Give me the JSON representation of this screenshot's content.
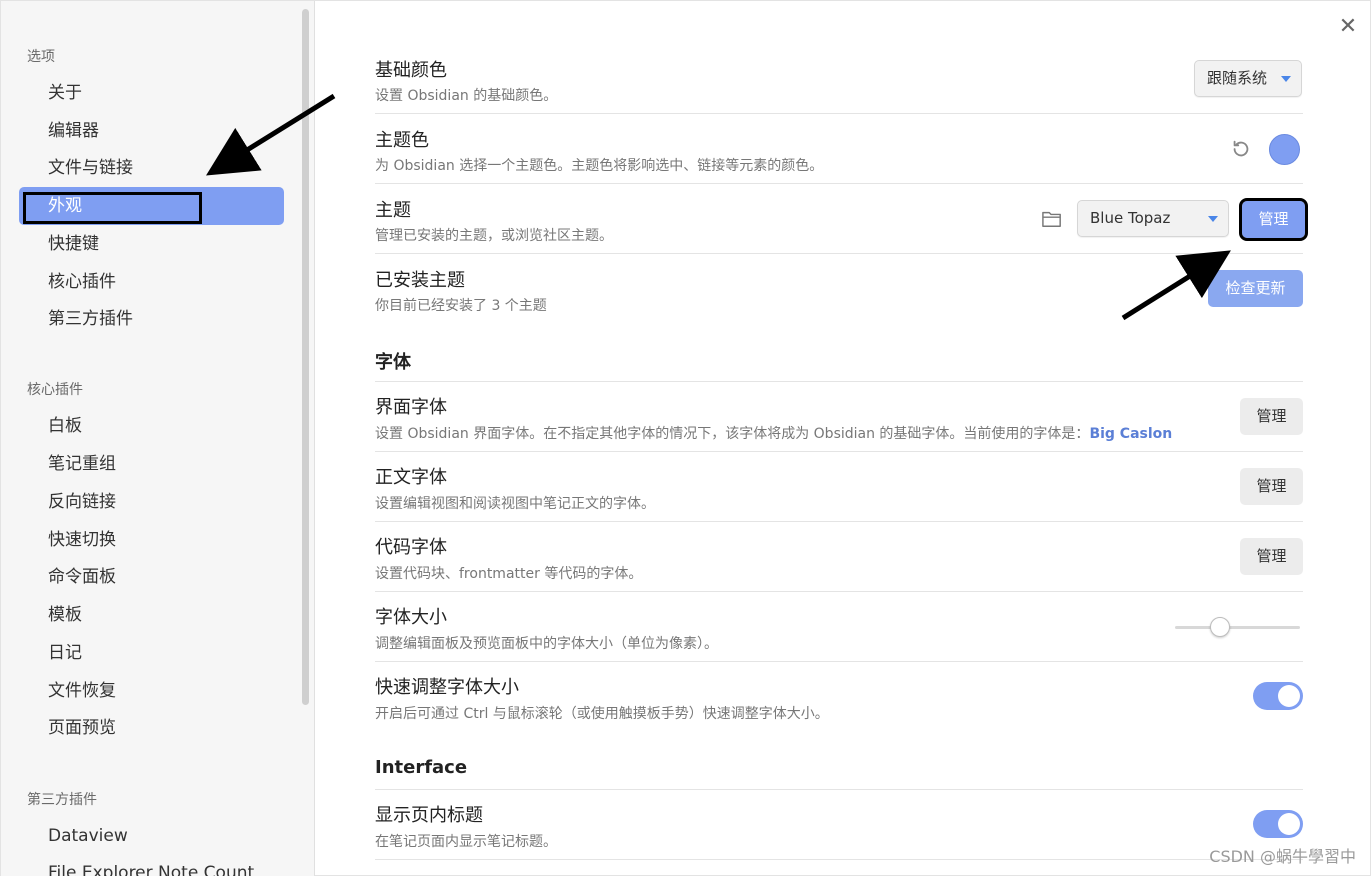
{
  "sidebar": {
    "group1_title": "选项",
    "group1": [
      "关于",
      "编辑器",
      "文件与链接",
      "外观",
      "快捷键",
      "核心插件",
      "第三方插件"
    ],
    "active": "外观",
    "group2_title": "核心插件",
    "group2": [
      "白板",
      "笔记重组",
      "反向链接",
      "快速切换",
      "命令面板",
      "模板",
      "日记",
      "文件恢复",
      "页面预览"
    ],
    "group3_title": "第三方插件",
    "group3": [
      "Dataview",
      "File Explorer Note Count"
    ]
  },
  "close_icon": "close-icon",
  "settings": {
    "base_color": {
      "name": "基础颜色",
      "desc": "设置 Obsidian 的基础颜色。",
      "value": "跟随系统"
    },
    "accent_color": {
      "name": "主题色",
      "desc": "为 Obsidian 选择一个主题色。主题色将影响选中、链接等元素的颜色。",
      "color": "#7f9ef2"
    },
    "theme": {
      "name": "主题",
      "desc": "管理已安装的主题，或浏览社区主题。",
      "value": "Blue Topaz",
      "manage": "管理"
    },
    "installed": {
      "name": "已安装主题",
      "desc": "你目前已经安装了 3 个主题",
      "button": "检查更新"
    }
  },
  "font_section": {
    "title": "字体",
    "interface_font": {
      "name": "界面字体",
      "desc": "设置 Obsidian 界面字体。在不指定其他字体的情况下，该字体将成为 Obsidian 的基础字体。当前使用的字体是：",
      "current": "Big Caslon",
      "button": "管理"
    },
    "text_font": {
      "name": "正文字体",
      "desc": "设置编辑视图和阅读视图中笔记正文的字体。",
      "button": "管理"
    },
    "code_font": {
      "name": "代码字体",
      "desc": "设置代码块、frontmatter 等代码的字体。",
      "button": "管理"
    },
    "font_size": {
      "name": "字体大小",
      "desc": "调整编辑面板及预览面板中的字体大小（单位为像素）。",
      "slider_fraction": 0.33
    },
    "quick_font": {
      "name": "快速调整字体大小",
      "desc": "开启后可通过 Ctrl 与鼠标滚轮（或使用触摸板手势）快速调整字体大小。",
      "enabled": true
    }
  },
  "interface_section": {
    "title": "Interface",
    "inline_title": {
      "name": "显示页内标题",
      "desc": "在笔记页面内显示笔记标题。",
      "enabled": true
    }
  },
  "watermark": "CSDN @蜗牛學習中",
  "colors": {
    "accent": "#7f9ef2",
    "accent_light": "#8aa8f0"
  }
}
